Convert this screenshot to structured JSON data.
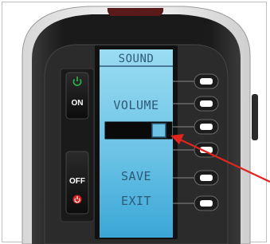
{
  "screen": {
    "title": "SOUND",
    "menu": {
      "volume_label": "VOLUME",
      "volume_level": 0.85,
      "save_label": "SAVE",
      "exit_label": "EXIT"
    }
  },
  "left_buttons": {
    "on_label": "ON",
    "off_label": "OFF"
  },
  "colors": {
    "lcd_top": "#8fd6ee",
    "lcd_bottom": "#3aa6d6",
    "lcd_text": "#2c5a78",
    "power_on": "#2ea84b",
    "power_off": "#d42020",
    "arrow": "#e0251f",
    "remote_body": "#151515"
  },
  "icons": {
    "on_button": "power-icon",
    "off_button": "power-icon",
    "soft_keys": "minus-bar-icon"
  }
}
